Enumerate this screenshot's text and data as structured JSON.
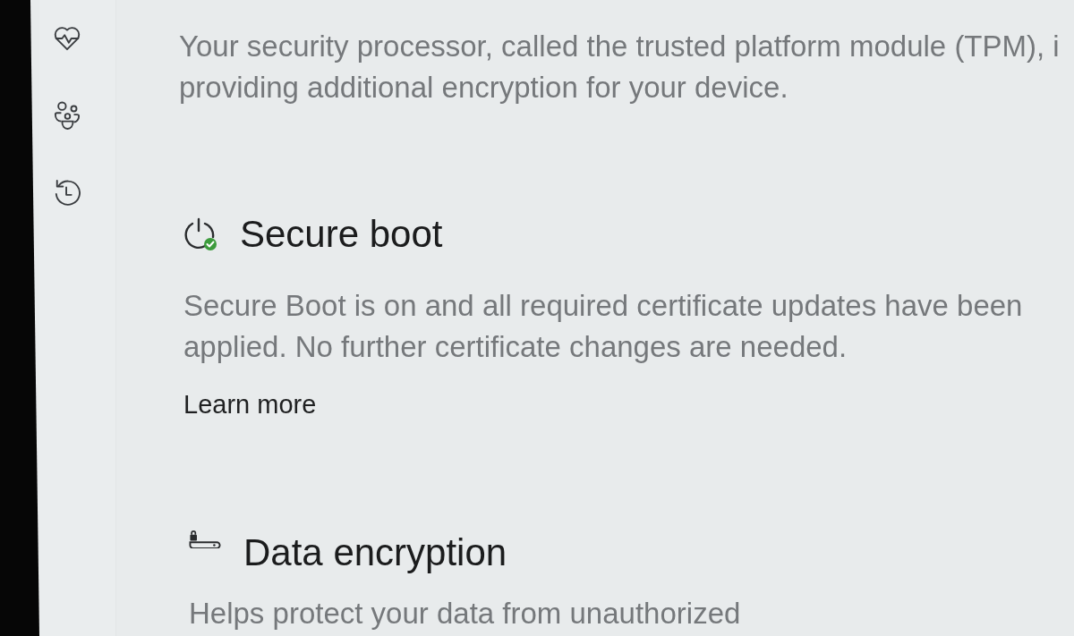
{
  "intro": {
    "lines": [
      "Your security processor, called the trusted platform module (TPM), i",
      "providing additional encryption for your device."
    ]
  },
  "sections": [
    {
      "kind": "secure_boot",
      "title": "Secure boot",
      "lines": [
        "Secure Boot is on and all required certificate updates have been",
        "applied. No further certificate changes are needed."
      ],
      "link": "Learn more"
    },
    {
      "kind": "data_encryption",
      "title": "Data encryption",
      "lines": [
        "Helps protect your data from unauthorized"
      ]
    }
  ]
}
